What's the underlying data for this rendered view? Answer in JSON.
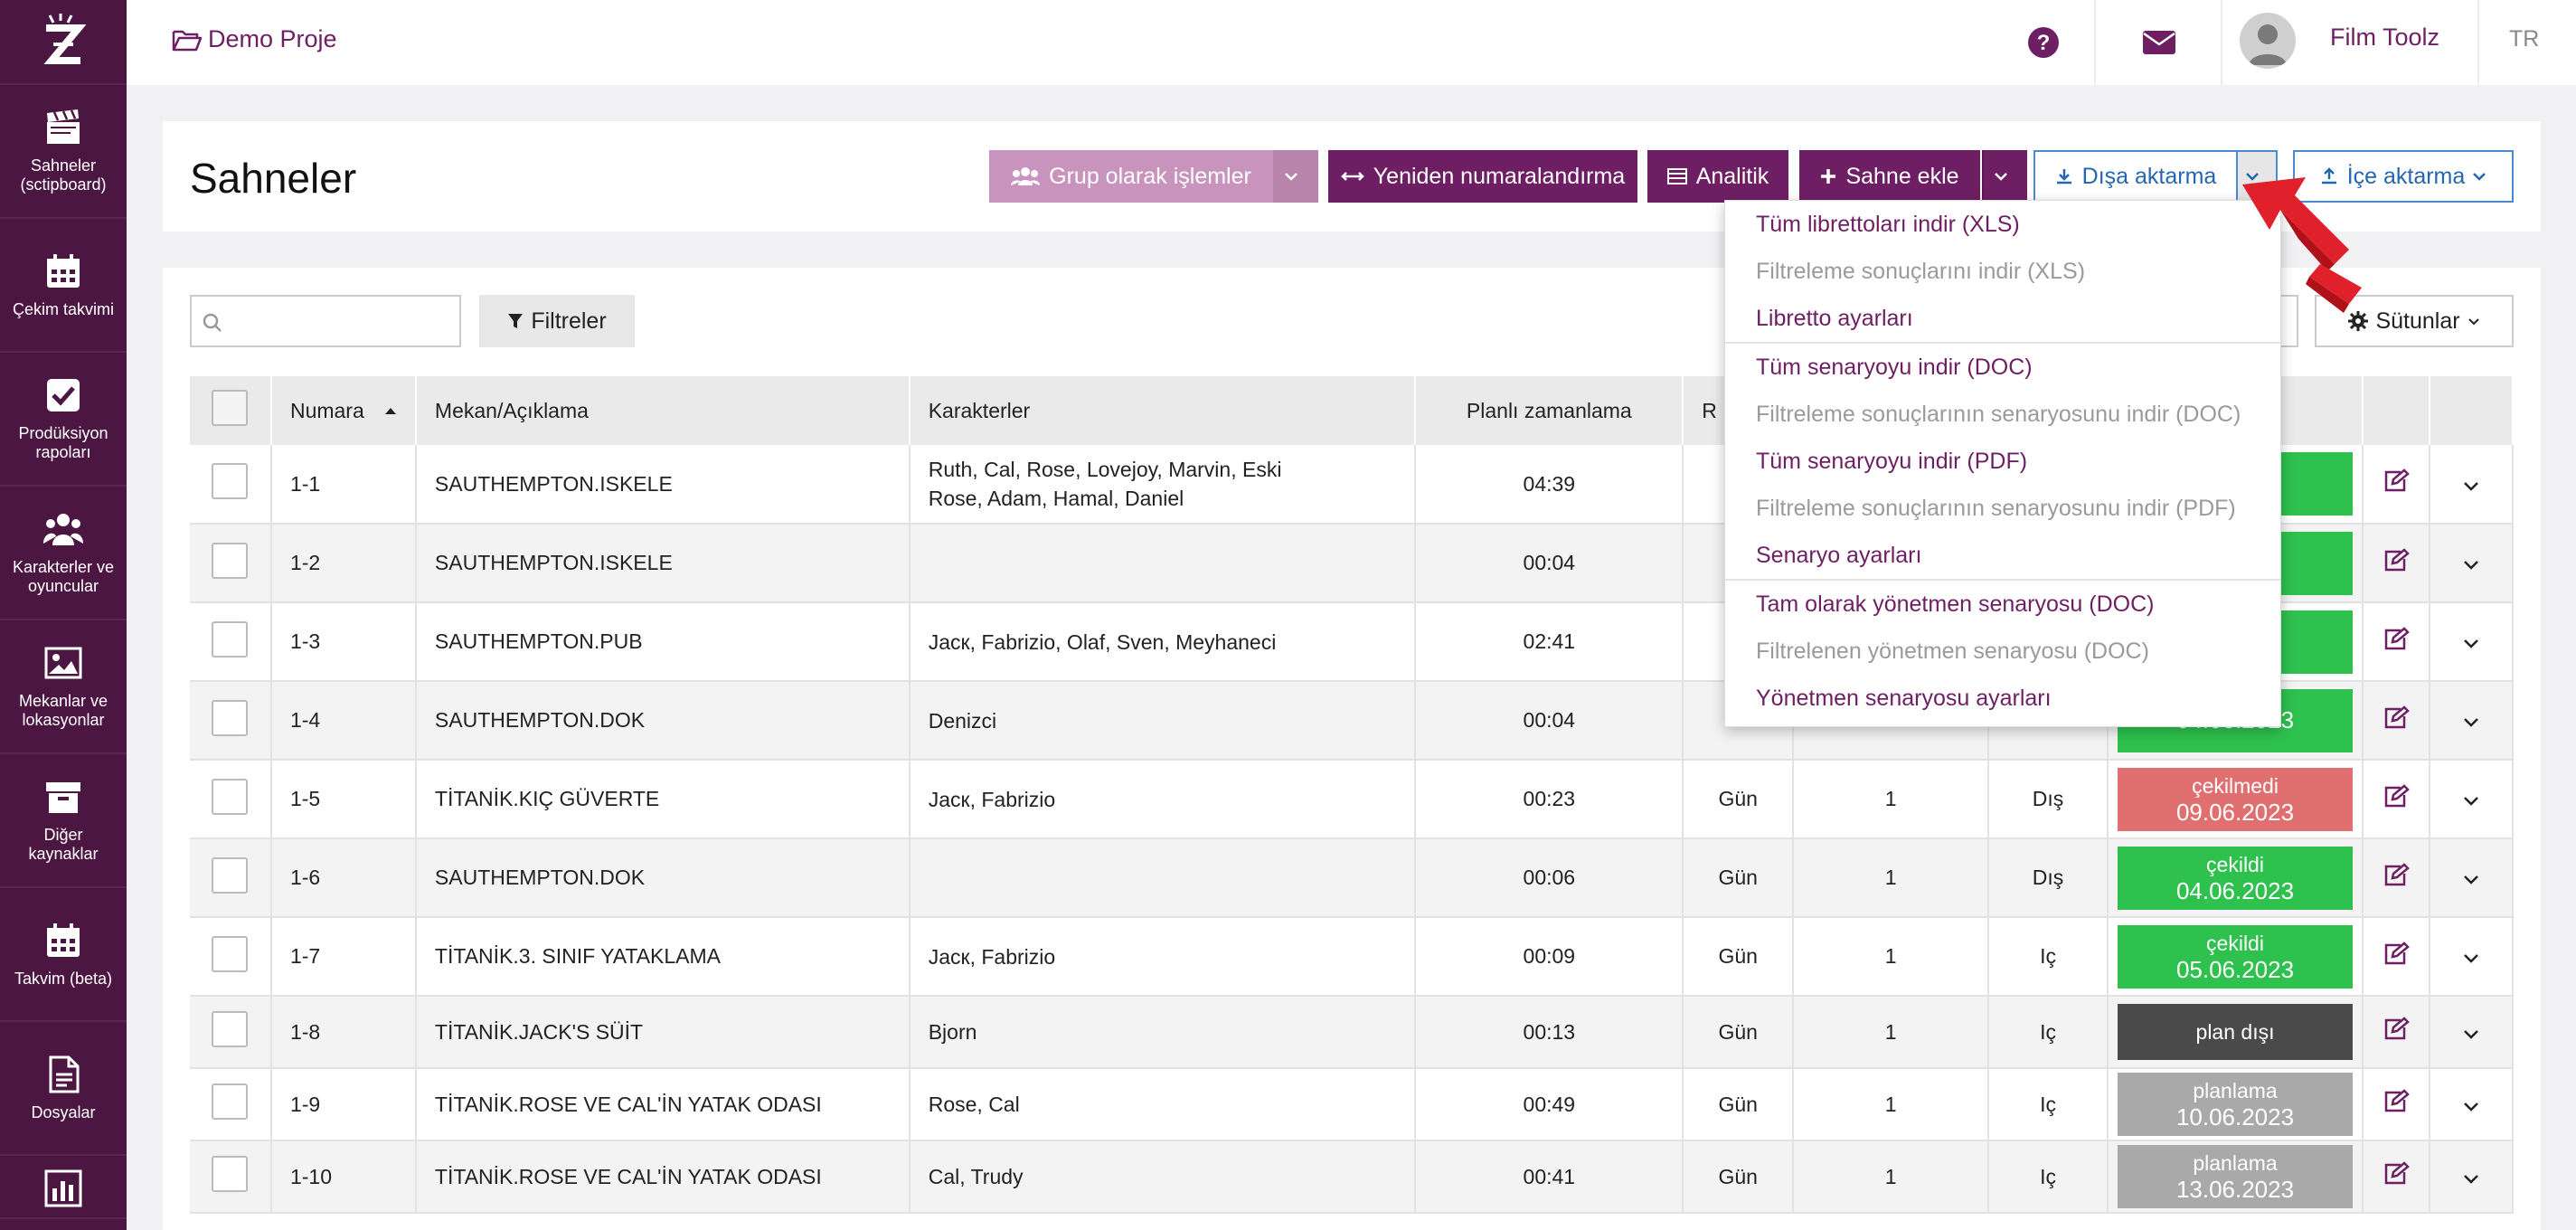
{
  "sidebar": {
    "items": [
      {
        "label": "Sahneler\n(sctipboard)",
        "icon": "clapperboard-icon"
      },
      {
        "label": "Çekim takvimi",
        "icon": "calendar-icon"
      },
      {
        "label": "Prodüksiyon\nrapoları",
        "icon": "checkbox-icon"
      },
      {
        "label": "Karakterler ve\noyuncular",
        "icon": "users-icon"
      },
      {
        "label": "Mekanlar ve\nlokasyonlar",
        "icon": "image-icon"
      },
      {
        "label": "Diğer kaynaklar",
        "icon": "archive-icon"
      },
      {
        "label": "Takvim (beta)",
        "icon": "calendar-icon"
      },
      {
        "label": "Dosyalar",
        "icon": "file-icon"
      }
    ]
  },
  "topbar": {
    "project": "Demo Proje",
    "user": "Film Toolz",
    "lang": "TR"
  },
  "header": {
    "title": "Sahneler",
    "group_ops": "Grup olarak işlemler",
    "renumber": "Yeniden numaralandırma",
    "analytics": "Analitik",
    "add_scene": "Sahne ekle",
    "export": "Dışa aktarma",
    "import": "İçe aktarma"
  },
  "toolbar": {
    "filters": "Filtreler",
    "columns": "Sütunlar"
  },
  "table": {
    "headers": {
      "number": "Numara",
      "location": "Mekan/Açıklama",
      "characters": "Karakterler",
      "planned": "Planlı zamanlama",
      "r": "R"
    },
    "rows": [
      {
        "num": "1-1",
        "loc": "SAUTHEMPTON.ISKELE",
        "chars": "Ruth, Cal, Rose, Lovejoy, Marvin, Eski\nRose, Adam, Hamal, Daniel",
        "time": "04:39",
        "day": "",
        "n": "",
        "io": "",
        "status": "",
        "date": "3",
        "color": "green"
      },
      {
        "num": "1-2",
        "loc": "SAUTHEMPTON.ISKELE",
        "chars": "",
        "time": "00:04",
        "day": "",
        "n": "",
        "io": "",
        "status": "",
        "date": "3",
        "color": "green"
      },
      {
        "num": "1-3",
        "loc": "SAUTHEMPTON.PUB",
        "chars": "Jacк, Fabrizio, Olaf, Sven, Meyhaneci",
        "time": "02:41",
        "day": "",
        "n": "",
        "io": "",
        "status": "",
        "date": "3",
        "color": "green"
      },
      {
        "num": "1-4",
        "loc": "SAUTHEMPTON.DOK",
        "chars": "Denizci",
        "time": "00:04",
        "day": "",
        "n": "",
        "io": "",
        "status": "",
        "date": "04.06.2023",
        "color": "green"
      },
      {
        "num": "1-5",
        "loc": "TİTANİK.KIÇ GÜVERTE",
        "chars": "Jacк, Fabrizio",
        "time": "00:23",
        "day": "Gün",
        "n": "1",
        "io": "Dış",
        "status": "çekilmedi",
        "date": "09.06.2023",
        "color": "red"
      },
      {
        "num": "1-6",
        "loc": "SAUTHEMPTON.DOK",
        "chars": "",
        "time": "00:06",
        "day": "Gün",
        "n": "1",
        "io": "Dış",
        "status": "çekildi",
        "date": "04.06.2023",
        "color": "green"
      },
      {
        "num": "1-7",
        "loc": "TİTANİK.3. SINIF YATAKLAMA",
        "chars": "Jacк, Fabrizio",
        "time": "00:09",
        "day": "Gün",
        "n": "1",
        "io": "Iç",
        "status": "çekildi",
        "date": "05.06.2023",
        "color": "green"
      },
      {
        "num": "1-8",
        "loc": "TİTANİK.JACK'S SÜİT",
        "chars": "Bjorn",
        "time": "00:13",
        "day": "Gün",
        "n": "1",
        "io": "Iç",
        "status": "plan dışı",
        "date": "",
        "color": "dark"
      },
      {
        "num": "1-9",
        "loc": "TİTANİK.ROSE VE CAL'İN YATAK ODASI",
        "chars": "Rose, Cal",
        "time": "00:49",
        "day": "Gün",
        "n": "1",
        "io": "Iç",
        "status": "planlama",
        "date": "10.06.2023",
        "color": "gray"
      },
      {
        "num": "1-10",
        "loc": "TİTANİK.ROSE VE CAL'İN YATAK ODASI",
        "chars": "Cal, Trudy",
        "time": "00:41",
        "day": "Gün",
        "n": "1",
        "io": "Iç",
        "status": "planlama",
        "date": "13.06.2023",
        "color": "gray"
      }
    ]
  },
  "export_menu": [
    {
      "label": "Tüm librettoları indir (XLS)",
      "disabled": false
    },
    {
      "label": "Filtreleme sonuçlarını indir (XLS)",
      "disabled": true
    },
    {
      "label": "Libretto ayarları",
      "disabled": false,
      "divider_after": true
    },
    {
      "label": "Tüm senaryoyu indir (DOC)",
      "disabled": false
    },
    {
      "label": "Filtreleme sonuçlarının senaryosunu indir (DOC)",
      "disabled": true
    },
    {
      "label": "Tüm senaryoyu indir (PDF)",
      "disabled": false
    },
    {
      "label": "Filtreleme sonuçlarının senaryosunu indir (PDF)",
      "disabled": true
    },
    {
      "label": "Senaryo ayarları",
      "disabled": false,
      "divider_after": true
    },
    {
      "label": "Tam olarak yönetmen senaryosu (DOC)",
      "disabled": false
    },
    {
      "label": "Filtrelenen yönetmen senaryosu (DOC)",
      "disabled": true
    },
    {
      "label": "Yönetmen senaryosu ayarları",
      "disabled": false
    }
  ],
  "colors": {
    "brand": "#6e1f63",
    "sidebar": "#4b1642",
    "green": "#2ec14e",
    "red": "#e07070",
    "dark": "#4a4a4a",
    "gray": "#a9a9a9",
    "blue": "#2566b0"
  }
}
